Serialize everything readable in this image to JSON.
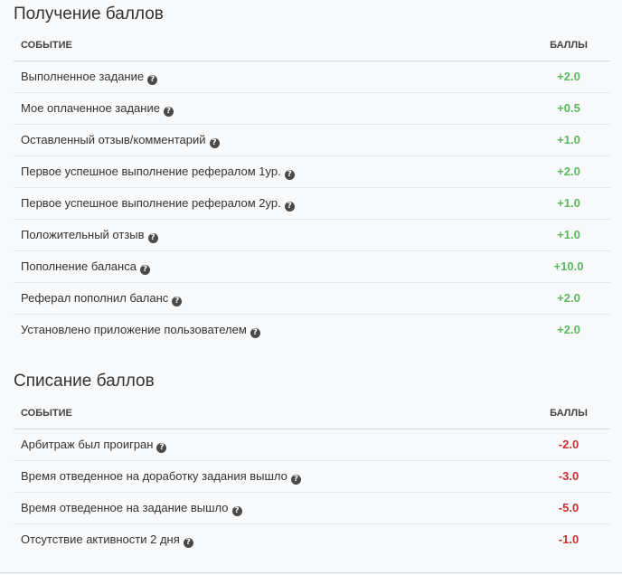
{
  "earning": {
    "title": "Получение баллов",
    "col_event": "Событие",
    "col_points": "Баллы",
    "rows": [
      {
        "event": "Выполненное задание",
        "points": "+2.0"
      },
      {
        "event": "Мое оплаченное задание",
        "points": "+0.5"
      },
      {
        "event": "Оставленный отзыв/комментарий",
        "points": "+1.0"
      },
      {
        "event": "Первое успешное выполнение рефералом 1ур.",
        "points": "+2.0"
      },
      {
        "event": "Первое успешное выполнение рефералом 2ур.",
        "points": "+1.0"
      },
      {
        "event": "Положительный отзыв",
        "points": "+1.0"
      },
      {
        "event": "Пополнение баланса",
        "points": "+10.0"
      },
      {
        "event": "Реферал пополнил баланс",
        "points": "+2.0"
      },
      {
        "event": "Установлено приложение пользователем",
        "points": "+2.0"
      }
    ]
  },
  "spending": {
    "title": "Списание баллов",
    "col_event": "Событие",
    "col_points": "Баллы",
    "rows": [
      {
        "event": "Арбитраж был проигран",
        "points": "-2.0"
      },
      {
        "event": "Время отведенное на доработку задания вышло",
        "points": "-3.0"
      },
      {
        "event": "Время отведенное на задание вышло",
        "points": "-5.0"
      },
      {
        "event": "Отсутствие активности 2 дня",
        "points": "-1.0"
      }
    ]
  },
  "icons": {
    "help": "question-circle-icon"
  },
  "colors": {
    "positive": "#5cb85c",
    "negative": "#c9302c"
  }
}
